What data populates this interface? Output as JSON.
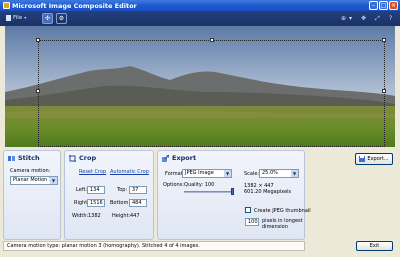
{
  "window": {
    "title": "Microsoft Image Composite Editor",
    "minimize_glyph": "–",
    "maximize_glyph": "□",
    "close_glyph": "×"
  },
  "toolbar": {
    "file_label": "File",
    "file_caret": "▾",
    "icons": [
      "stitch-mode-icon",
      "settings-icon",
      "zoom-icon",
      "pan-icon",
      "help-icon"
    ]
  },
  "stitch": {
    "heading": "Stitch",
    "camera_motion_label": "Camera motion:",
    "camera_motion_value": "Planar Motion 3"
  },
  "crop": {
    "heading": "Crop",
    "reset_link": "Reset Crop",
    "auto_link": "Automatic Crop",
    "left_label": "Left:",
    "left_value": "134",
    "top_label": "Top:",
    "top_value": "37",
    "right_label": "Right:",
    "right_value": "1516",
    "bottom_label": "Bottom:",
    "bottom_value": "484",
    "width_label": "Width:",
    "width_value": "1382",
    "height_label": "Height:",
    "height_value": "447"
  },
  "export": {
    "heading": "Export",
    "format_label": "Format:",
    "format_value": "JPEG Image",
    "options_label": "Options:",
    "quality_label": "Quality: 100",
    "quality_fraction": 1.0,
    "scale_label": "Scale:",
    "scale_value": "25.0%",
    "dimensions": "1382 × 447",
    "megapixels": "601.20 Megapixels",
    "thumbnail_label": "Create JPEG thumbnail",
    "longest_value": "100",
    "longest_label_1": "pixels in longest",
    "longest_label_2": "dimension",
    "export_button": "Export..."
  },
  "status": {
    "text": "Camera motion type: planar motion 3 (homography). Stitched 4 of 4 images."
  },
  "exit_button": "Exit",
  "colors": {
    "titlebar": "#1f5acf",
    "toolbar": "#1a3264",
    "panel_border": "#b7c4dc",
    "link": "#1a3fa8"
  }
}
